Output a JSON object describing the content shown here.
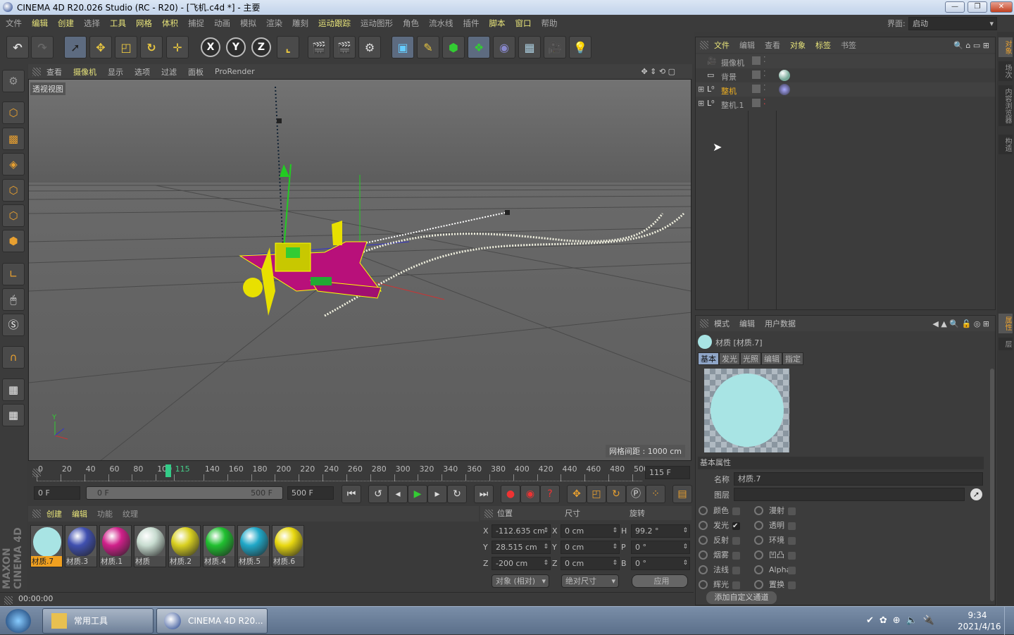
{
  "window": {
    "title": "CINEMA 4D R20.026 Studio (RC - R20) - [飞机.c4d *] - 主要",
    "min": "—",
    "max": "❐",
    "close": "✕"
  },
  "menu": {
    "items": [
      "文件",
      "编辑",
      "创建",
      "选择",
      "工具",
      "网格",
      "体积",
      "捕捉",
      "动画",
      "模拟",
      "渲染",
      "雕刻",
      "运动跟踪",
      "运动图形",
      "角色",
      "流水线",
      "插件",
      "脚本",
      "窗口",
      "帮助"
    ],
    "highlighted": [
      1,
      2,
      4,
      5,
      6,
      12,
      17,
      18
    ],
    "layout_label": "界面:",
    "layout_value": "启动"
  },
  "toolbar": {
    "axis": [
      "X",
      "Y",
      "Z"
    ]
  },
  "viewport": {
    "menu": [
      "查看",
      "摄像机",
      "显示",
      "选项",
      "过滤",
      "面板",
      "ProRender"
    ],
    "label": "透视视图",
    "grid_info": "网格间距 : 1000 cm",
    "axis_y": "Y",
    "axis_z": "Z",
    "axis_x": "X"
  },
  "timeline": {
    "ticks": [
      "0",
      "20",
      "40",
      "60",
      "80",
      "100",
      "115",
      "140",
      "160",
      "180",
      "200",
      "220",
      "240",
      "260",
      "280",
      "300",
      "320",
      "340",
      "360",
      "380",
      "400",
      "420",
      "440",
      "460",
      "480",
      "500"
    ],
    "current_frame": 115,
    "current_field": "115 F",
    "start": "0 F",
    "range_start": "0 F",
    "range_end": "500 F",
    "end": "500 F"
  },
  "materials": {
    "menu": [
      "创建",
      "编辑",
      "功能",
      "纹理"
    ],
    "items": [
      {
        "name": "材质.7",
        "color": "#a8e4e4",
        "selected": true
      },
      {
        "name": "材质.3",
        "color": "#4050b0"
      },
      {
        "name": "材质.1",
        "color": "#d0208a"
      },
      {
        "name": "材质",
        "color": "#c8dcd0"
      },
      {
        "name": "材质.2",
        "color": "#d8d020"
      },
      {
        "name": "材质.4",
        "color": "#20c030"
      },
      {
        "name": "材质.5",
        "color": "#20a8c8"
      },
      {
        "name": "材质.6",
        "color": "#e8d810"
      }
    ]
  },
  "coords": {
    "headers": [
      "位置",
      "尺寸",
      "旋转"
    ],
    "rows": [
      {
        "a": "X",
        "pos": "-112.635 cm",
        "b": "X",
        "size": "0 cm",
        "c": "H",
        "rot": "99.2 °"
      },
      {
        "a": "Y",
        "pos": "28.515 cm",
        "b": "Y",
        "size": "0 cm",
        "c": "P",
        "rot": "0 °"
      },
      {
        "a": "Z",
        "pos": "-200 cm",
        "b": "Z",
        "size": "0 cm",
        "c": "B",
        "rot": "0 °"
      }
    ],
    "mode": "对象 (相对)",
    "size_mode": "绝对尺寸",
    "apply": "应用"
  },
  "status": {
    "time": "00:00:00"
  },
  "objects": {
    "menu": [
      "文件",
      "编辑",
      "查看",
      "对象",
      "标签",
      "书签"
    ],
    "items": [
      {
        "name": "摄像机",
        "active": false
      },
      {
        "name": "背景",
        "active": false
      },
      {
        "name": "整机",
        "active": true
      },
      {
        "name": "整机.1",
        "active": false
      }
    ]
  },
  "attributes": {
    "menu": [
      "模式",
      "编辑",
      "用户数据"
    ],
    "title": "材质 [材质.7]",
    "tabs": [
      "基本",
      "发光",
      "光照",
      "编辑",
      "指定"
    ],
    "active_tab": 0,
    "section": "基本属性",
    "name_label": "名称",
    "name_value": "材质.7",
    "layer_label": "图层",
    "channels_left": [
      {
        "n": "颜色",
        "c": false
      },
      {
        "n": "发光",
        "c": true
      },
      {
        "n": "反射",
        "c": false
      },
      {
        "n": "烟雾",
        "c": false
      },
      {
        "n": "法线",
        "c": false
      },
      {
        "n": "辉光",
        "c": false
      }
    ],
    "channels_right": [
      {
        "n": "漫射",
        "c": false
      },
      {
        "n": "透明",
        "c": false
      },
      {
        "n": "环境",
        "c": false
      },
      {
        "n": "凹凸",
        "c": false
      },
      {
        "n": "Alpha",
        "c": false
      },
      {
        "n": "置换",
        "c": false
      }
    ],
    "add_channel": "添加自定义通道",
    "preview_color": "#a8e4e4"
  },
  "side_tabs": {
    "top": [
      "对象",
      "场次",
      "内容浏览器",
      "构造"
    ],
    "bottom": [
      "属性",
      "层"
    ]
  },
  "branding": "MAXON CINEMA 4D",
  "taskbar": {
    "tasks": [
      "常用工具",
      "CINEMA 4D R20..."
    ],
    "time": "9:34",
    "date": "2021/4/16"
  },
  "colors": {
    "accent": "#e8e47a",
    "selection": "#f0a020",
    "panel": "#3c3c3c"
  }
}
